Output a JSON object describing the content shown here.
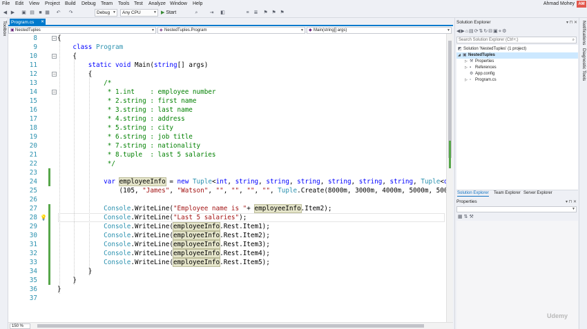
{
  "menu": [
    "File",
    "Edit",
    "View",
    "Project",
    "Build",
    "Debug",
    "Team",
    "Tools",
    "Test",
    "Analyze",
    "Window",
    "Help"
  ],
  "user": {
    "name": "Ahmad Mohey",
    "initials": "AM"
  },
  "toolbar": {
    "config": "Debug",
    "platform": "Any CPU",
    "start": "Start"
  },
  "left_tabs": [
    "Toolbox"
  ],
  "right_tabs": [
    "Notifications",
    "Diagnostic Tools"
  ],
  "document_tab": {
    "label": "Program.cs"
  },
  "nav": {
    "project": "NestedTuples",
    "class": "NestedTuples.Program",
    "member": "Main(string[] args)"
  },
  "code_lines": [
    {
      "n": "8",
      "text": "{"
    },
    {
      "n": "9",
      "text": "    class Program"
    },
    {
      "n": "10",
      "text": "    {"
    },
    {
      "n": "11",
      "text": "        static void Main(string[] args)"
    },
    {
      "n": "12",
      "text": "        {"
    },
    {
      "n": "13",
      "text": "            /*"
    },
    {
      "n": "14",
      "text": "             * 1.int    : employee number"
    },
    {
      "n": "15",
      "text": "             * 2.string : first name"
    },
    {
      "n": "16",
      "text": "             * 3.string : last name"
    },
    {
      "n": "17",
      "text": "             * 4.string : address"
    },
    {
      "n": "18",
      "text": "             * 5.string : city"
    },
    {
      "n": "19",
      "text": "             * 6.string : job title"
    },
    {
      "n": "20",
      "text": "             * 7.string : nationality"
    },
    {
      "n": "21",
      "text": "             * 8.tuple  : last 5 salaries"
    },
    {
      "n": "22",
      "text": "             */"
    },
    {
      "n": "23",
      "text": ""
    },
    {
      "n": "24",
      "text": "            var employeeInfo = new Tuple<int, string, string, string, string, string, string, Tuple<dec:"
    },
    {
      "n": "25",
      "text": "                (105, \"James\", \"Watson\", \"\", \"\", \"\", \"\", Tuple.Create(8000m, 3000m, 4000m, 5000m, 5000m"
    },
    {
      "n": "26",
      "text": ""
    },
    {
      "n": "27",
      "text": "            Console.WriteLine(\"Employee name is \"+ employeeInfo.Item2);"
    },
    {
      "n": "28",
      "text": "            Console.WriteLine(\"Last 5 salaries\");"
    },
    {
      "n": "29",
      "text": "            Console.WriteLine(employeeInfo.Rest.Item1);"
    },
    {
      "n": "30",
      "text": "            Console.WriteLine(employeeInfo.Rest.Item2);"
    },
    {
      "n": "31",
      "text": "            Console.WriteLine(employeeInfo.Rest.Item3);"
    },
    {
      "n": "32",
      "text": "            Console.WriteLine(employeeInfo.Rest.Item4);"
    },
    {
      "n": "33",
      "text": "            Console.WriteLine(employeeInfo.Rest.Item5);"
    },
    {
      "n": "34",
      "text": "        }"
    },
    {
      "n": "35",
      "text": "    }"
    },
    {
      "n": "36",
      "text": "}"
    },
    {
      "n": "37",
      "text": ""
    }
  ],
  "zoom": "150 %",
  "solution_explorer": {
    "title": "Solution Explorer",
    "search_placeholder": "Search Solution Explorer (Ctrl+;)",
    "tree": [
      "Solution 'NestedTuples' (1 project)",
      "NestedTuples",
      "Properties",
      "References",
      "App.config",
      "Program.cs"
    ],
    "tabs": [
      "Solution Explorer",
      "Team Explorer",
      "Server Explorer"
    ]
  },
  "properties": {
    "title": "Properties"
  },
  "watermark": "Udemy",
  "colors": {
    "accent": "#007acc",
    "keyword": "#0000ff",
    "type": "#2b91af",
    "comment": "#008000",
    "string": "#a31515",
    "change_bar": "#57a64a"
  }
}
